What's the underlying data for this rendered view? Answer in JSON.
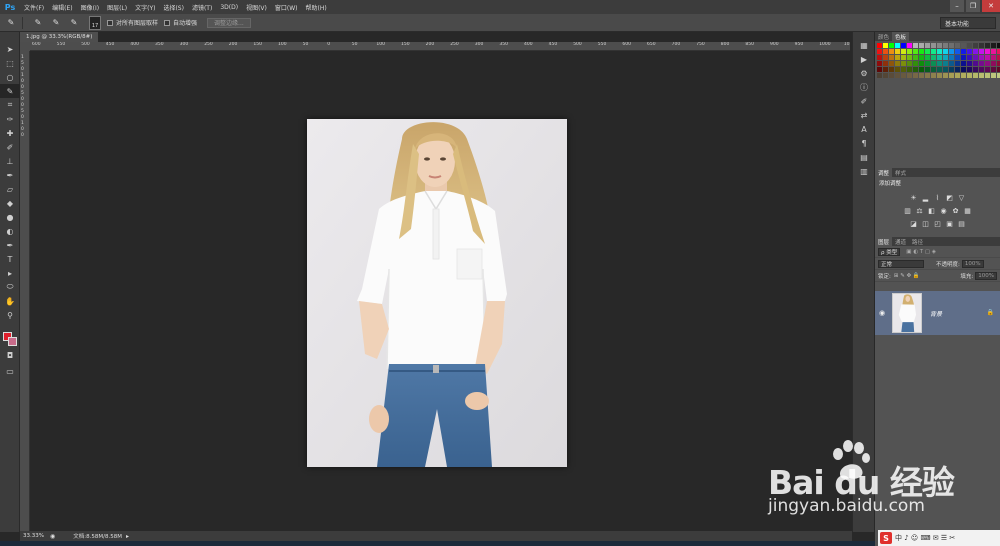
{
  "app": {
    "logo": "Ps"
  },
  "menu": [
    "文件(F)",
    "编辑(E)",
    "图像(I)",
    "图层(L)",
    "文字(Y)",
    "选择(S)",
    "滤镜(T)",
    "3D(D)",
    "视图(V)",
    "窗口(W)",
    "帮助(H)"
  ],
  "options": {
    "brush_size": "17",
    "sample_all_layers": "对所有图层取样",
    "auto_enhance": "自动增强",
    "refine_edge": "调整边缘...",
    "workspace": "基本功能"
  },
  "document": {
    "tab_title": "1.jpg @ 33.3%(RGB/8#)",
    "zoom": "33.33%",
    "doc_size": "文档:8.58M/8.58M"
  },
  "ruler": {
    "top_ticks": [
      "600",
      "550",
      "500",
      "450",
      "400",
      "350",
      "300",
      "250",
      "200",
      "150",
      "100",
      "50",
      "0",
      "50",
      "100",
      "150",
      "200",
      "250",
      "300",
      "350",
      "400",
      "450",
      "500",
      "550",
      "600",
      "650",
      "700",
      "750",
      "800",
      "850",
      "900",
      "950",
      "1000",
      "1050"
    ],
    "left_ticks": [
      "1",
      "5",
      "0",
      "1",
      "0",
      "0",
      "5",
      "0",
      "0",
      "5",
      "0",
      "1",
      "0",
      "0"
    ]
  },
  "panels": {
    "swatch_tabs": [
      "颜色",
      "色板"
    ],
    "adjust_tabs": [
      "调整",
      "样式"
    ],
    "adjust_title": "添加调整",
    "layers_tabs": [
      "图层",
      "通道",
      "路径"
    ],
    "kind_label": "ρ 类型",
    "blend_mode": "正常",
    "opacity_label": "不透明度:",
    "opacity_value": "100%",
    "lock_label": "锁定:",
    "fill_label": "填充:",
    "fill_value": "100%",
    "layer_name": "背景"
  },
  "watermark": {
    "brand": "Bai du 经验",
    "url": "jingyan.baidu.com"
  },
  "ime": {
    "label": "S",
    "text": "中 ♪ ☺ ⌨ ✉ ☰ ✂"
  },
  "colors": {
    "foreground": "#e0202d",
    "background": "#c86b8a",
    "accent": "#2fa4f5",
    "layer_selected": "#5f6e89"
  }
}
